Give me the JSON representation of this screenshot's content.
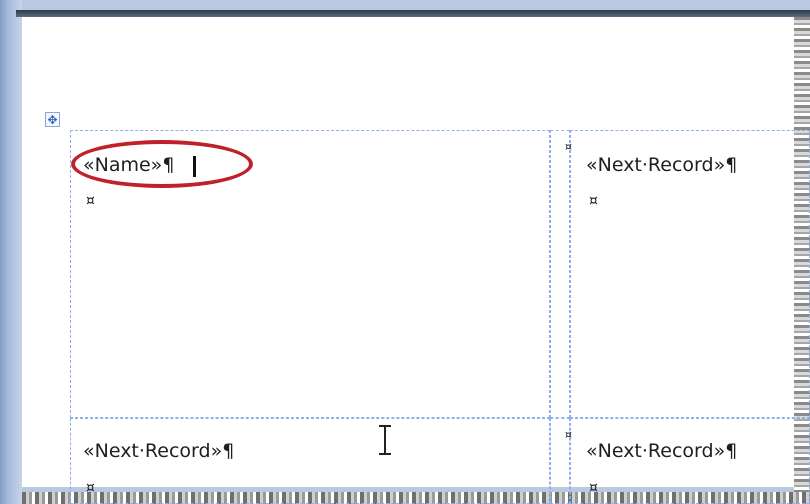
{
  "labels": {
    "cell_1": {
      "field": "«Name»",
      "pilcrow": "¶",
      "end_mark": "¤"
    },
    "cell_2": {
      "field": "«Next·Record»",
      "pilcrow": "¶",
      "end_mark": "¤"
    },
    "cell_3": {
      "field": "«Next·Record»",
      "pilcrow": "¶",
      "end_mark": "¤"
    },
    "cell_4": {
      "field": "«Next·Record»",
      "pilcrow": "¶",
      "end_mark": "¤"
    }
  },
  "row_end_mark": "¤",
  "colors": {
    "highlight_ellipse": "#c0202a",
    "gridlines": "#8fb0e6"
  },
  "icons": {
    "table_move_handle": "move-arrows-icon",
    "mouse_pointer": "i-beam-cursor-icon"
  }
}
